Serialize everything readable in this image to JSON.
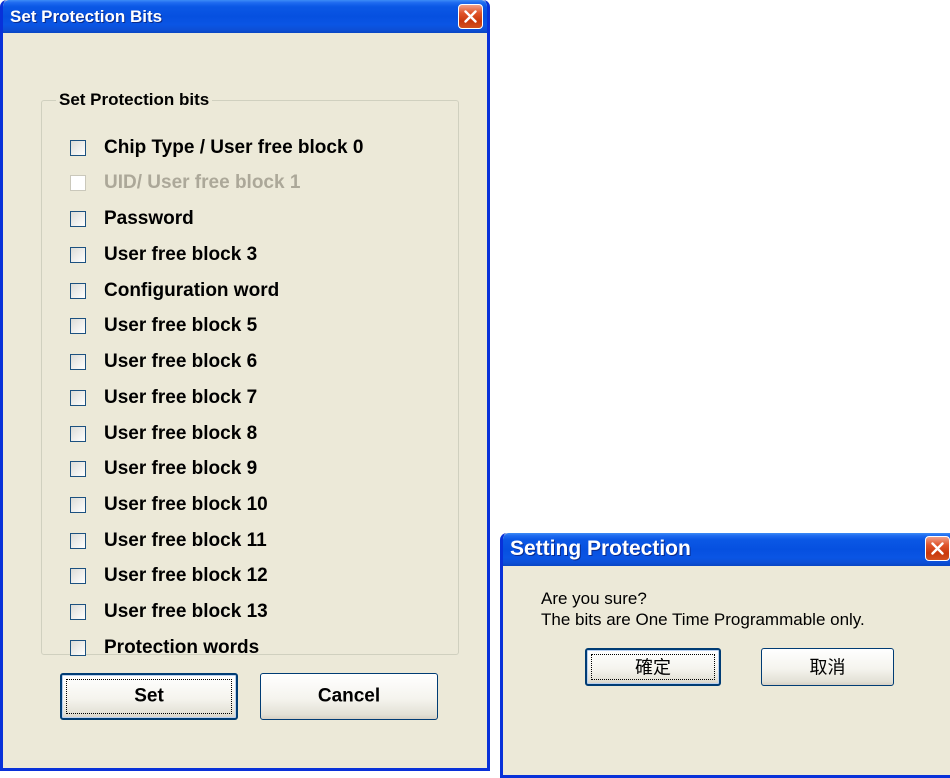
{
  "main_dialog": {
    "title": "Set Protection Bits",
    "group_label": "Set Protection bits",
    "checkboxes": [
      {
        "label": "Chip Type / User free block 0",
        "checked": false,
        "enabled": true
      },
      {
        "label": "UID/ User free block 1",
        "checked": false,
        "enabled": false
      },
      {
        "label": "Password",
        "checked": false,
        "enabled": true
      },
      {
        "label": "User free block 3",
        "checked": false,
        "enabled": true
      },
      {
        "label": "Configuration word",
        "checked": false,
        "enabled": true
      },
      {
        "label": "User free block 5",
        "checked": false,
        "enabled": true
      },
      {
        "label": "User free block 6",
        "checked": false,
        "enabled": true
      },
      {
        "label": "User free block 7",
        "checked": false,
        "enabled": true
      },
      {
        "label": "User free block 8",
        "checked": false,
        "enabled": true
      },
      {
        "label": "User free block 9",
        "checked": false,
        "enabled": true
      },
      {
        "label": "User free block 10",
        "checked": false,
        "enabled": true
      },
      {
        "label": "User free block 11",
        "checked": false,
        "enabled": true
      },
      {
        "label": "User free block 12",
        "checked": false,
        "enabled": true
      },
      {
        "label": "User free block 13",
        "checked": false,
        "enabled": true
      },
      {
        "label": "Protection words",
        "checked": false,
        "enabled": true
      }
    ],
    "set_label": "Set",
    "cancel_label": "Cancel"
  },
  "confirm_dialog": {
    "title": "Setting Protection",
    "message_line1": "Are you sure?",
    "message_line2": "The bits are One Time Programmable only.",
    "ok_label": "確定",
    "cancel_label": "取消"
  },
  "colors": {
    "titlebar_blue": "#0650e0",
    "window_face": "#ece9d8",
    "close_red": "#c9380c",
    "disabled_text": "#aca899"
  }
}
